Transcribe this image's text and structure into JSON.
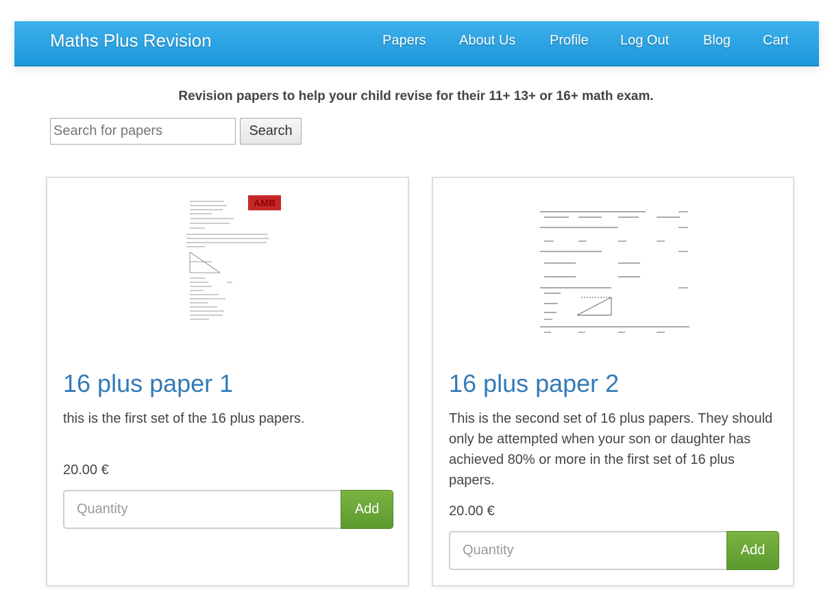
{
  "navbar": {
    "brand": "Maths Plus Revision",
    "links": [
      "Papers",
      "About Us",
      "Profile",
      "Log Out",
      "Blog",
      "Cart"
    ]
  },
  "tagline": "Revision papers to help your child revise for their 11+ 13+ or 16+ math exam.",
  "search": {
    "placeholder": "Search for papers",
    "button_label": "Search"
  },
  "products": [
    {
      "title": "16 plus paper 1",
      "description": "this is the first set of the 16 plus papers.",
      "price": "20.00 €",
      "quantity_placeholder": "Quantity",
      "add_label": "Add",
      "thumbnail_logo": "AMB"
    },
    {
      "title": "16 plus paper 2",
      "description": "This is the second set of 16 plus papers. They should only be attempted when your son or daughter has achieved 80% or more in the first set of 16 plus papers.",
      "price": "20.00 €",
      "quantity_placeholder": "Quantity",
      "add_label": "Add"
    }
  ],
  "colors": {
    "navbar": "#1c97dc",
    "title_link": "#337ab7",
    "add_button": "#6aa636"
  }
}
